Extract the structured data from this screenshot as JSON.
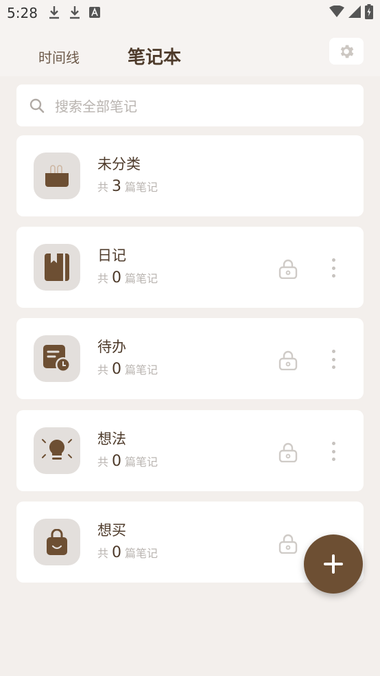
{
  "status_bar": {
    "time": "5:28"
  },
  "header": {
    "tabs": [
      {
        "label": "时间线"
      },
      {
        "label": "笔记本"
      }
    ]
  },
  "search": {
    "placeholder": "搜索全部笔记"
  },
  "notebooks": [
    {
      "title": "未分类",
      "count_prefix": "共",
      "count": "3",
      "count_suffix": "篇笔记",
      "icon": "basket-icon",
      "locked": false
    },
    {
      "title": "日记",
      "count_prefix": "共",
      "count": "0",
      "count_suffix": "篇笔记",
      "icon": "diary-book-icon",
      "locked": true
    },
    {
      "title": "待办",
      "count_prefix": "共",
      "count": "0",
      "count_suffix": "篇笔记",
      "icon": "todo-clock-icon",
      "locked": true
    },
    {
      "title": "想法",
      "count_prefix": "共",
      "count": "0",
      "count_suffix": "篇笔记",
      "icon": "lightbulb-icon",
      "locked": true
    },
    {
      "title": "想买",
      "count_prefix": "共",
      "count": "0",
      "count_suffix": "篇笔记",
      "icon": "shopping-bag-icon",
      "locked": true
    }
  ],
  "colors": {
    "accent": "#6d4f33",
    "text_dark": "#4e3b2b",
    "icon_bg": "#e3dfdc",
    "page_bg": "#f3efec"
  }
}
